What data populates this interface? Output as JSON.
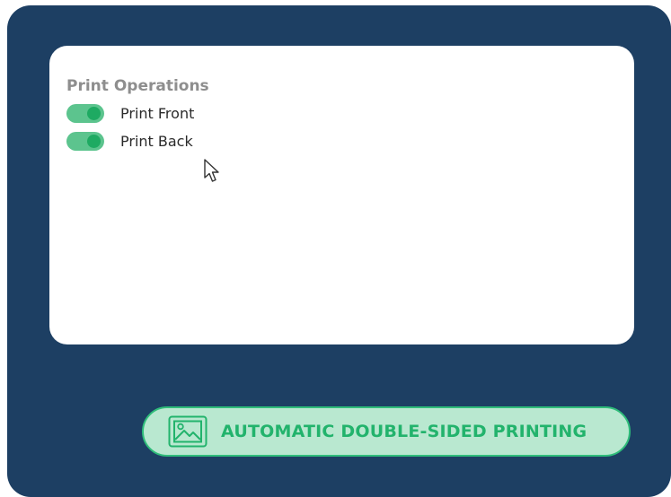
{
  "panel": {
    "section_title": "Print Operations",
    "toggles": [
      {
        "label": "Print Front",
        "enabled": true
      },
      {
        "label": "Print Back",
        "enabled": true
      }
    ]
  },
  "feature_badge": {
    "icon": "image-icon",
    "label": "AUTOMATIC DOUBLE-SIDED PRINTING"
  },
  "colors": {
    "frame_background": "#1d3f63",
    "toggle_track": "#5cc48e",
    "toggle_knob": "#1eaa62",
    "badge_fill": "#b9e8d0",
    "badge_accent": "#22b36c"
  }
}
